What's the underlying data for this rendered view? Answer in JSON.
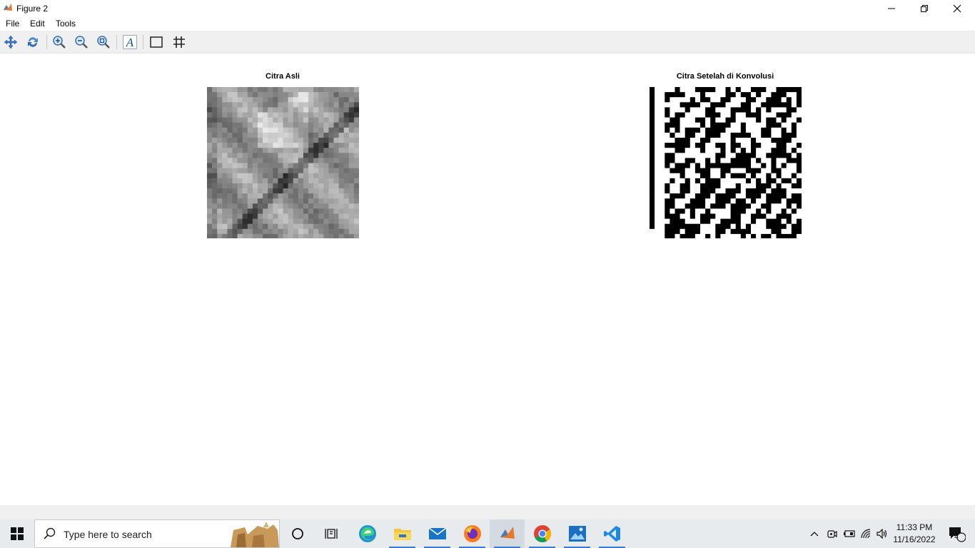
{
  "window": {
    "title": "Figure 2",
    "controls": {
      "minimize": "minimize-icon",
      "maximize": "restore-icon",
      "close": "close-icon"
    }
  },
  "menu": {
    "items": [
      "File",
      "Edit",
      "Tools"
    ]
  },
  "toolbar": {
    "buttons": [
      "pan-icon",
      "rotate-3d-icon",
      "zoom-in-icon",
      "zoom-out-icon",
      "zoom-fit-icon",
      "insert-text-icon",
      "box-icon",
      "grid-icon"
    ]
  },
  "figure": {
    "left_title": "Citra Asli",
    "right_title": "Citra Setelah di Konvolusi"
  },
  "taskbar": {
    "search_placeholder": "Type here to search",
    "apps": [
      "task-view-icon",
      "widgets-icon",
      "edge-icon",
      "file-explorer-icon",
      "mail-icon",
      "firefox-icon",
      "matlab-icon",
      "chrome-icon",
      "photos-icon",
      "vscode-icon"
    ],
    "clock_time": "11:33 PM",
    "clock_date": "11/16/2022",
    "notification_count": "4"
  },
  "colors": {
    "accent": "#3b7bd4",
    "taskbar": "#e8ebee",
    "toolbar": "#f0f0f0"
  }
}
